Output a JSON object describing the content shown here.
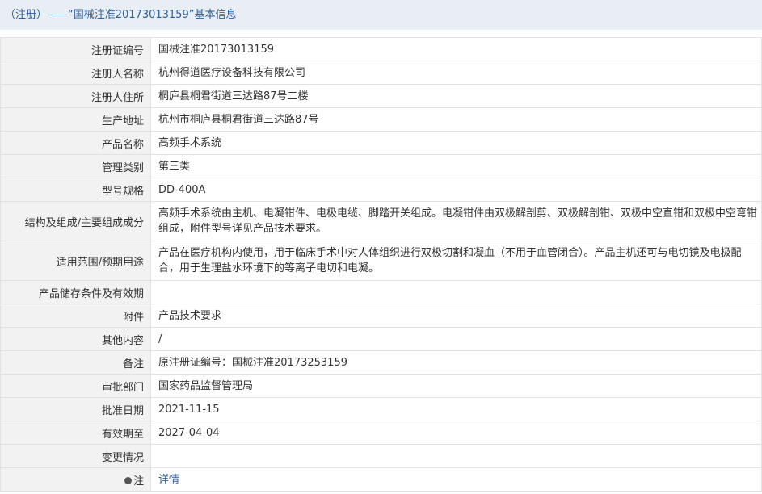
{
  "header": {
    "title": "（注册）——“国械注准20173013159”基本信息"
  },
  "rows": [
    {
      "label": "注册证编号",
      "value": "国械注准20173013159"
    },
    {
      "label": "注册人名称",
      "value": "杭州得道医疗设备科技有限公司"
    },
    {
      "label": "注册人住所",
      "value": "桐庐县桐君街道三达路87号二楼"
    },
    {
      "label": "生产地址",
      "value": "杭州市桐庐县桐君街道三达路87号"
    },
    {
      "label": "产品名称",
      "value": "高频手术系统"
    },
    {
      "label": "管理类别",
      "value": "第三类"
    },
    {
      "label": "型号规格",
      "value": "DD-400A"
    },
    {
      "label": "结构及组成/主要组成成分",
      "value": "高频手术系统由主机、电凝钳件、电极电缆、脚踏开关组成。电凝钳件由双极解剖剪、双极解剖钳、双极中空直钳和双极中空弯钳组成，附件型号详见产品技术要求。"
    },
    {
      "label": "适用范围/预期用途",
      "value": "产品在医疗机构内使用，用于临床手术中对人体组织进行双极切割和凝血（不用于血管闭合）。产品主机还可与电切镜及电极配合，用于生理盐水环境下的等离子电切和电凝。"
    },
    {
      "label": "产品储存条件及有效期",
      "value": ""
    },
    {
      "label": "附件",
      "value": "产品技术要求"
    },
    {
      "label": "其他内容",
      "value": "/"
    },
    {
      "label": "备注",
      "value": "原注册证编号：国械注准20173253159"
    },
    {
      "label": "审批部门",
      "value": "国家药品监督管理局"
    },
    {
      "label": "批准日期",
      "value": "2021-11-15"
    },
    {
      "label": "有效期至",
      "value": "2027-04-04"
    },
    {
      "label": "变更情况",
      "value": ""
    }
  ],
  "note": {
    "label": "注",
    "icon": "note-dot-icon",
    "link": "详情"
  }
}
